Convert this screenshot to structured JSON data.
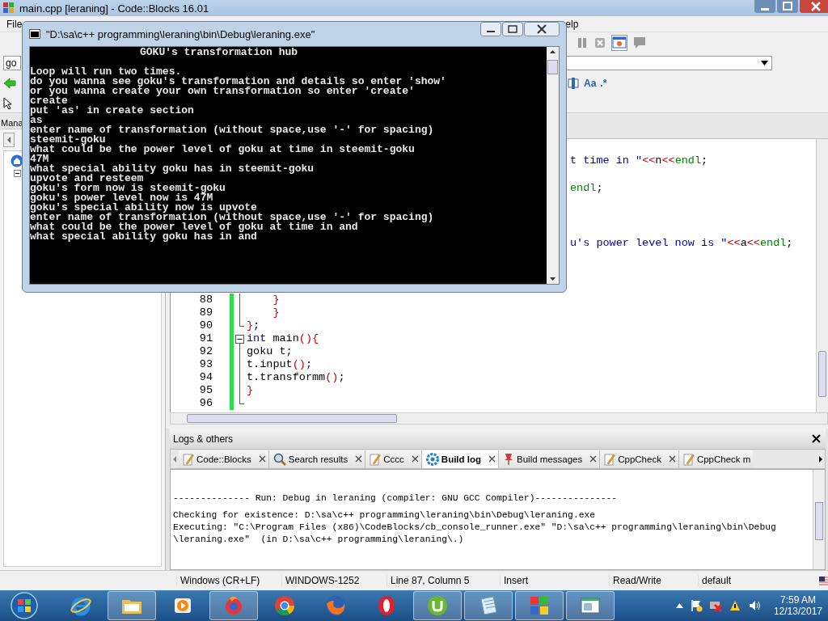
{
  "app_window": {
    "title": "main.cpp [leraning] - Code::Blocks 16.01"
  },
  "menu": [
    "File",
    "elp"
  ],
  "toolbar": {
    "combo_value": "go",
    "search_buttons": [
      "Aa",
      ".*"
    ]
  },
  "management": {
    "title": "Mana"
  },
  "editor": {
    "fragments": [
      [
        {
          "text": "t time in \"",
          "kind": "str"
        },
        {
          "text": "<<",
          "kind": "op"
        },
        {
          "text": "n",
          "kind": "plain"
        },
        {
          "text": "<<",
          "kind": "op"
        },
        {
          "text": "endl",
          "kind": "endl"
        },
        {
          "text": ";",
          "kind": "plain"
        }
      ],
      [
        {
          "text": "endl",
          "kind": "endl"
        },
        {
          "text": ";",
          "kind": "plain"
        }
      ],
      [
        {
          "text": "u's power level now is \"",
          "kind": "str"
        },
        {
          "text": "<<",
          "kind": "op"
        },
        {
          "text": "a",
          "kind": "plain"
        },
        {
          "text": "<<",
          "kind": "op"
        },
        {
          "text": "endl",
          "kind": "endl"
        },
        {
          "text": ";",
          "kind": "plain"
        }
      ]
    ],
    "lines": [
      {
        "number": "88",
        "kind": "line",
        "tokens": [
          {
            "text": "    }",
            "kind": "op"
          }
        ]
      },
      {
        "number": "89",
        "kind": "line",
        "tokens": [
          {
            "text": "    }",
            "kind": "op"
          }
        ]
      },
      {
        "number": "90",
        "kind": "end",
        "tokens": [
          {
            "text": "}",
            "kind": "op"
          },
          {
            "text": ";",
            "kind": "plain"
          }
        ]
      },
      {
        "number": "91",
        "kind": "start",
        "tokens": [
          {
            "text": "int",
            "kind": "kw"
          },
          {
            "text": " main",
            "kind": "plain"
          },
          {
            "text": "(){",
            "kind": "op"
          }
        ]
      },
      {
        "number": "92",
        "kind": "line",
        "tokens": [
          {
            "text": "goku t;",
            "kind": "plain"
          }
        ]
      },
      {
        "number": "93",
        "kind": "line",
        "tokens": [
          {
            "text": "t.input",
            "kind": "plain"
          },
          {
            "text": "()",
            "kind": "op"
          },
          {
            "text": ";",
            "kind": "plain"
          }
        ]
      },
      {
        "number": "94",
        "kind": "line",
        "tokens": [
          {
            "text": "t.transformm",
            "kind": "plain"
          },
          {
            "text": "()",
            "kind": "op"
          },
          {
            "text": ";",
            "kind": "plain"
          }
        ]
      },
      {
        "number": "95",
        "kind": "line",
        "tokens": [
          {
            "text": "}",
            "kind": "op"
          }
        ]
      },
      {
        "number": "96",
        "kind": "end"
      }
    ]
  },
  "logs": {
    "title": "Logs & others",
    "tabs": [
      {
        "label": "Code::Blocks",
        "kind": "note",
        "selected": false,
        "closable": true
      },
      {
        "label": "Search results",
        "kind": "search",
        "selected": false,
        "closable": true
      },
      {
        "label": "Cccc",
        "kind": "note",
        "selected": false,
        "closable": true
      },
      {
        "label": "Build log",
        "kind": "build",
        "selected": true,
        "closable": true
      },
      {
        "label": "Build messages",
        "kind": "messages",
        "selected": false,
        "closable": true
      },
      {
        "label": "CppCheck",
        "kind": "note",
        "selected": false,
        "closable": true
      },
      {
        "label": "CppCheck m",
        "kind": "note",
        "selected": false,
        "closable": false
      }
    ],
    "lines": [
      "-------------- Run: Debug in leraning (compiler: GNU GCC Compiler)---------------",
      "Checking for existence: D:\\sa\\c++ programming\\leraning\\bin\\Debug\\leraning.exe",
      "Executing: \"C:\\Program Files (x86)\\CodeBlocks/cb_console_runner.exe\" \"D:\\sa\\c++ programming\\leraning\\bin\\Debug",
      "\\leraning.exe\"  (in D:\\sa\\c++ programming\\leraning\\.)"
    ]
  },
  "status_bar": [
    "Windows (CR+LF)",
    "WINDOWS-1252",
    "Line 87, Column 5",
    "Insert",
    "Read/Write",
    "default"
  ],
  "taskbar": {
    "apps": [
      {
        "kind": "ie",
        "active": false
      },
      {
        "kind": "folder",
        "active": true
      },
      {
        "kind": "media",
        "active": false
      },
      {
        "kind": "flame",
        "active": true
      },
      {
        "kind": "chrome",
        "active": false
      },
      {
        "kind": "firefox",
        "active": false
      },
      {
        "kind": "opera",
        "active": false
      },
      {
        "kind": "torrent",
        "active": true
      },
      {
        "kind": "notepad",
        "active": true
      },
      {
        "kind": "squares",
        "active": true
      },
      {
        "kind": "window",
        "active": true
      }
    ],
    "clock": {
      "time": "7:59 AM",
      "date": "12/13/2017"
    }
  },
  "console": {
    "title": "\"D:\\sa\\c++ programming\\leraning\\bin\\Debug\\leraning.exe\"",
    "heading": "GOKU's transformation hub",
    "lines": [
      "Loop will run two times.",
      "do you wanna see goku's transformation and details so enter 'show'",
      "or you wanna create your own transformation so enter 'create'",
      "create",
      "put 'as' in create section",
      "as",
      "enter name of transformation (without space,use '-' for spacing)",
      "steemit-goku",
      "what could be the power level of goku at time in steemit-goku",
      "47M",
      "what special ability goku has in steemit-goku",
      "upvote and resteem",
      "goku's form now is steemit-goku",
      "goku's power level now is 47M",
      "goku's special ability now is upvote",
      "enter name of transformation (without space,use '-' for spacing)",
      "what could be the power level of goku at time in and",
      "what special ability goku has in and"
    ]
  }
}
